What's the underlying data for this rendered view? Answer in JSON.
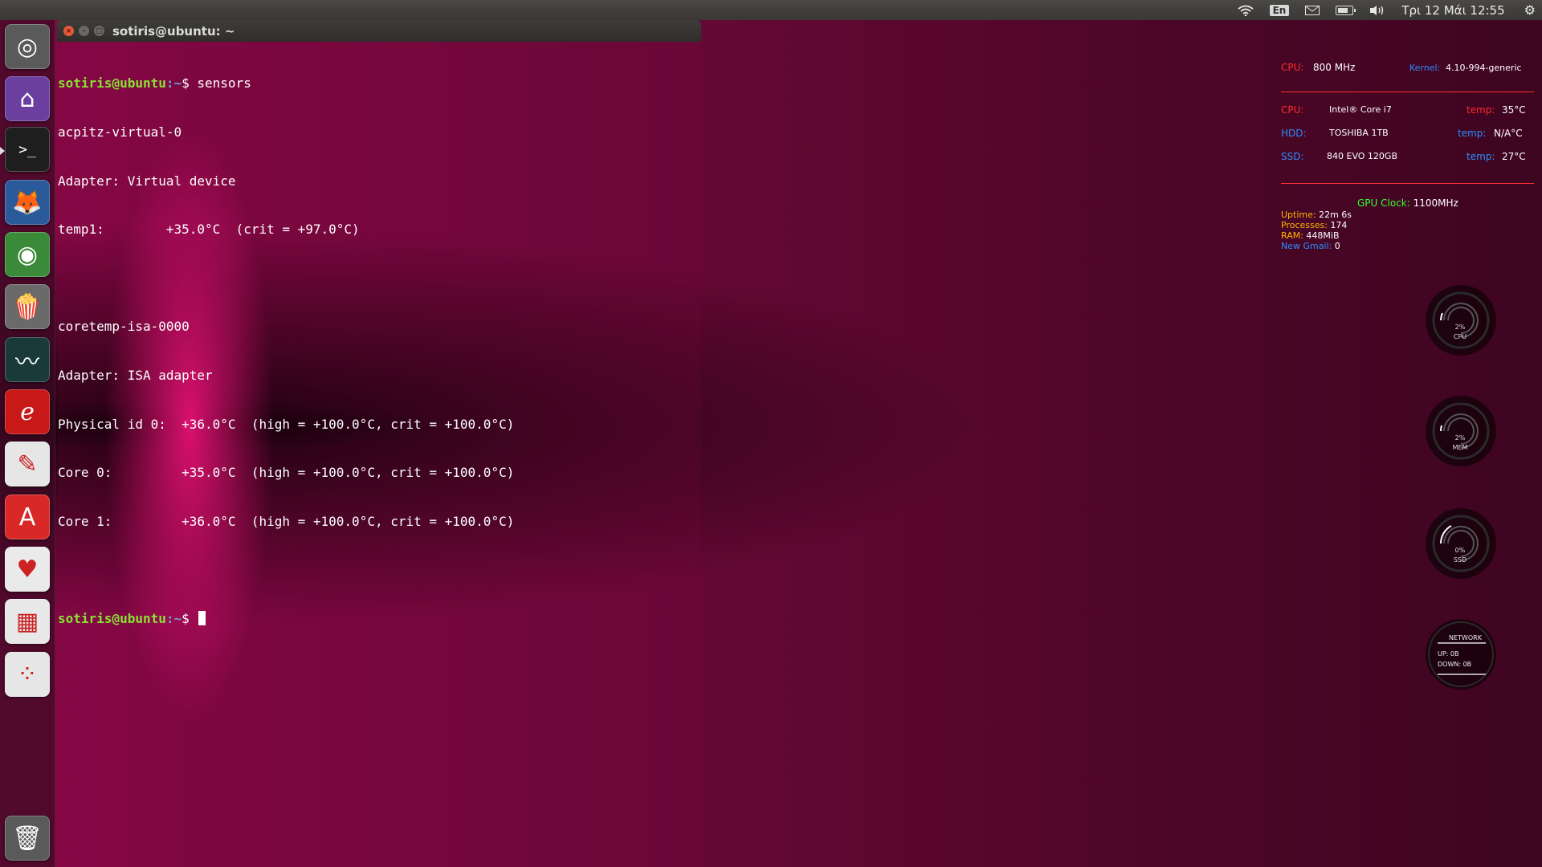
{
  "top_panel": {
    "language": "En",
    "clock": "Τρι 12 Μάι 12:55",
    "icons": [
      "wifi-icon",
      "keyboard-language-icon",
      "mail-icon",
      "battery-icon",
      "volume-icon",
      "settings-gear-icon"
    ]
  },
  "launcher": {
    "items": [
      {
        "name": "ubuntu-dash",
        "glyph": "◎",
        "color": "#5a5a5a"
      },
      {
        "name": "files-home",
        "glyph": "⌂",
        "color": "#6b3fa0"
      },
      {
        "name": "terminal",
        "glyph": ">_",
        "color": "#1e1e1e"
      },
      {
        "name": "firefox",
        "glyph": "🦊",
        "color": "#2a5a9a"
      },
      {
        "name": "chrome",
        "glyph": "◉",
        "color": "#3a8a3a"
      },
      {
        "name": "popcorn-time",
        "glyph": "🍿",
        "color": "#6a6a6a"
      },
      {
        "name": "system-monitor",
        "glyph": "〰",
        "color": "#1a3a3a"
      },
      {
        "name": "evince-reader",
        "glyph": "ℯ",
        "color": "#c81818"
      },
      {
        "name": "text-editor",
        "glyph": "✎",
        "color": "#e6e6e6"
      },
      {
        "name": "software-center",
        "glyph": "A",
        "color": "#d82828"
      },
      {
        "name": "cards-game",
        "glyph": "♥",
        "color": "#eaeaea"
      },
      {
        "name": "sudoku-game",
        "glyph": "▦",
        "color": "#e8e8e8"
      },
      {
        "name": "dots-game",
        "glyph": "⁘",
        "color": "#e6e6e6"
      },
      {
        "name": "trash",
        "glyph": "🗑",
        "color": "#5a5a5a"
      }
    ]
  },
  "terminal": {
    "title": "sotiris@ubuntu: ~",
    "prompt_user": "sotiris@ubuntu",
    "prompt_path": ":~",
    "prompt_symbol": "$",
    "command": " sensors",
    "lines": [
      "acpitz-virtual-0",
      "Adapter: Virtual device",
      "temp1:        +35.0°C  (crit = +97.0°C)",
      "",
      "coretemp-isa-0000",
      "Adapter: ISA adapter",
      "Physical id 0:  +36.0°C  (high = +100.0°C, crit = +100.0°C)",
      "Core 0:         +35.0°C  (high = +100.0°C, crit = +100.0°C)",
      "Core 1:         +36.0°C  (high = +100.0°C, crit = +100.0°C)",
      ""
    ]
  },
  "conky": {
    "cpu_label": "CPU:",
    "cpu_freq": "800 MHz",
    "kernel_label": "Kernel:",
    "kernel_value": "4.10-994-generic",
    "cpu_model_label": "CPU:",
    "cpu_model": "Intel® Core i7",
    "cpu_temp_label": "temp:",
    "cpu_temp": "35°C",
    "hdd_label": "HDD:",
    "hdd_model": "TOSHIBA 1TB",
    "hdd_temp_label": "temp:",
    "hdd_temp": "N/A°C",
    "ssd_label": "SSD:",
    "ssd_model": "840 EVO 120GB",
    "ssd_temp_label": "temp:",
    "ssd_temp": "27°C",
    "gpu_label": "GPU Clock:",
    "gpu_value": "1100MHz",
    "uptime_label": "Uptime:",
    "uptime_value": "22m 6s",
    "processes_label": "Processes:",
    "processes_value": "174",
    "ram_label": "RAM:",
    "ram_value": "448MiB",
    "gmail_label": "New Gmail:",
    "gmail_value": "0",
    "gauges": [
      {
        "pct": "2%",
        "label": "CPU"
      },
      {
        "pct": "2%",
        "label": "MEM"
      },
      {
        "pct": "0%",
        "label": "SSD"
      }
    ],
    "network": {
      "title": "NETWORK",
      "up_label": "UP:",
      "up_value": "0B",
      "down_label": "DOWN:",
      "down_value": "0B"
    }
  }
}
